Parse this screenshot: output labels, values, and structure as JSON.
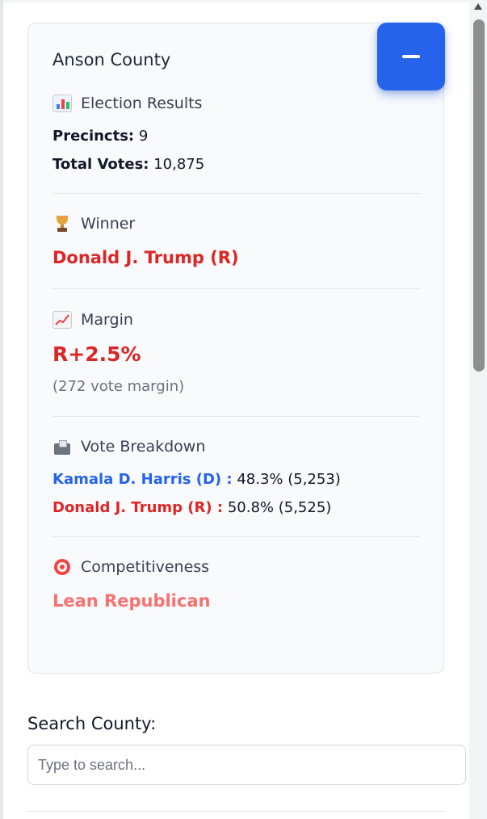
{
  "county": {
    "name": "Anson County"
  },
  "results": {
    "section_title": "Election Results",
    "precincts_label": "Precincts:",
    "precincts_value": "9",
    "total_votes_label": "Total Votes:",
    "total_votes_value": "10,875"
  },
  "winner": {
    "section_title": "Winner",
    "name": "Donald J. Trump (R)"
  },
  "margin": {
    "section_title": "Margin",
    "value": "R+2.5%",
    "detail": "(272 vote margin)"
  },
  "breakdown": {
    "section_title": "Vote Breakdown",
    "candidates": [
      {
        "name": "Kamala D. Harris (D) :",
        "result": "48.3% (5,253)",
        "color": "#2563eb"
      },
      {
        "name": "Donald J. Trump (R) :",
        "result": "50.8% (5,525)",
        "color": "#dc2626"
      }
    ]
  },
  "competitiveness": {
    "section_title": "Competitiveness",
    "value": "Lean Republican"
  },
  "search": {
    "label": "Search County:",
    "placeholder": "Type to search...",
    "value": ""
  },
  "colors": {
    "accent": "#2563eb",
    "republican": "#dc2626",
    "democrat": "#2563eb",
    "lean_republican": "#f87171"
  },
  "icons": {
    "collapse": "minus-icon",
    "results": "bar-chart-icon",
    "winner": "trophy-icon",
    "margin": "chart-increasing-icon",
    "breakdown": "ballot-box-icon",
    "competitiveness": "target-icon"
  }
}
